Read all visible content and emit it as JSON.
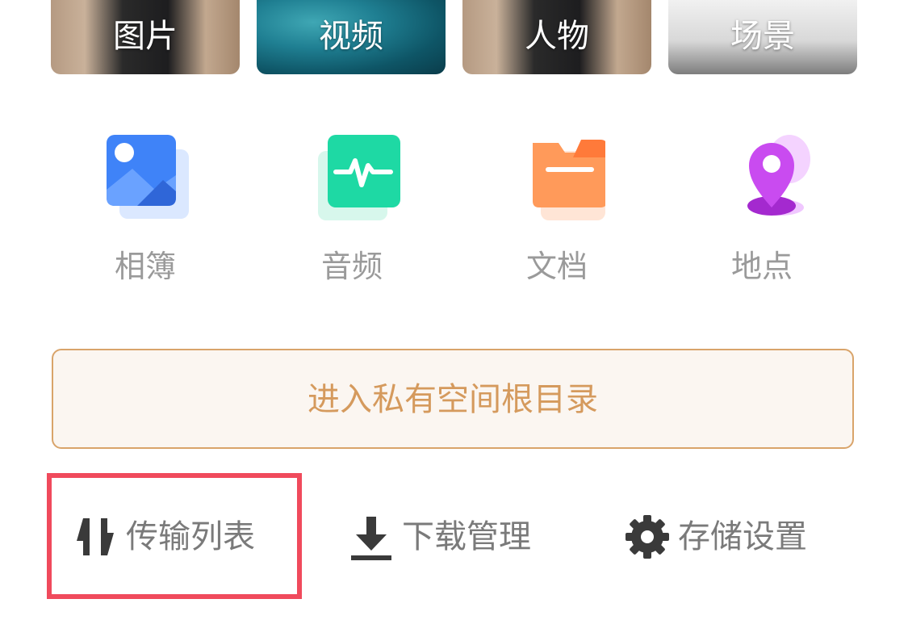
{
  "media_tiles": [
    {
      "label": "图片"
    },
    {
      "label": "视频"
    },
    {
      "label": "人物"
    },
    {
      "label": "场景"
    }
  ],
  "categories": [
    {
      "label": "相簿",
      "icon": "photo-album-icon",
      "color": "#3f83f8"
    },
    {
      "label": "音频",
      "icon": "audio-wave-icon",
      "color": "#1ed9a4"
    },
    {
      "label": "文档",
      "icon": "folder-icon",
      "color": "#ff9a5a"
    },
    {
      "label": "地点",
      "icon": "location-pin-icon",
      "color": "#c94bf0"
    }
  ],
  "enter_private_root": "进入私有空间根目录",
  "tools": [
    {
      "label": "传输列表",
      "icon": "transfer-arrows-icon"
    },
    {
      "label": "下载管理",
      "icon": "download-icon"
    },
    {
      "label": "存储设置",
      "icon": "gear-icon"
    }
  ],
  "colors": {
    "accent": "#d59a5d",
    "highlight": "#f04a5c"
  }
}
